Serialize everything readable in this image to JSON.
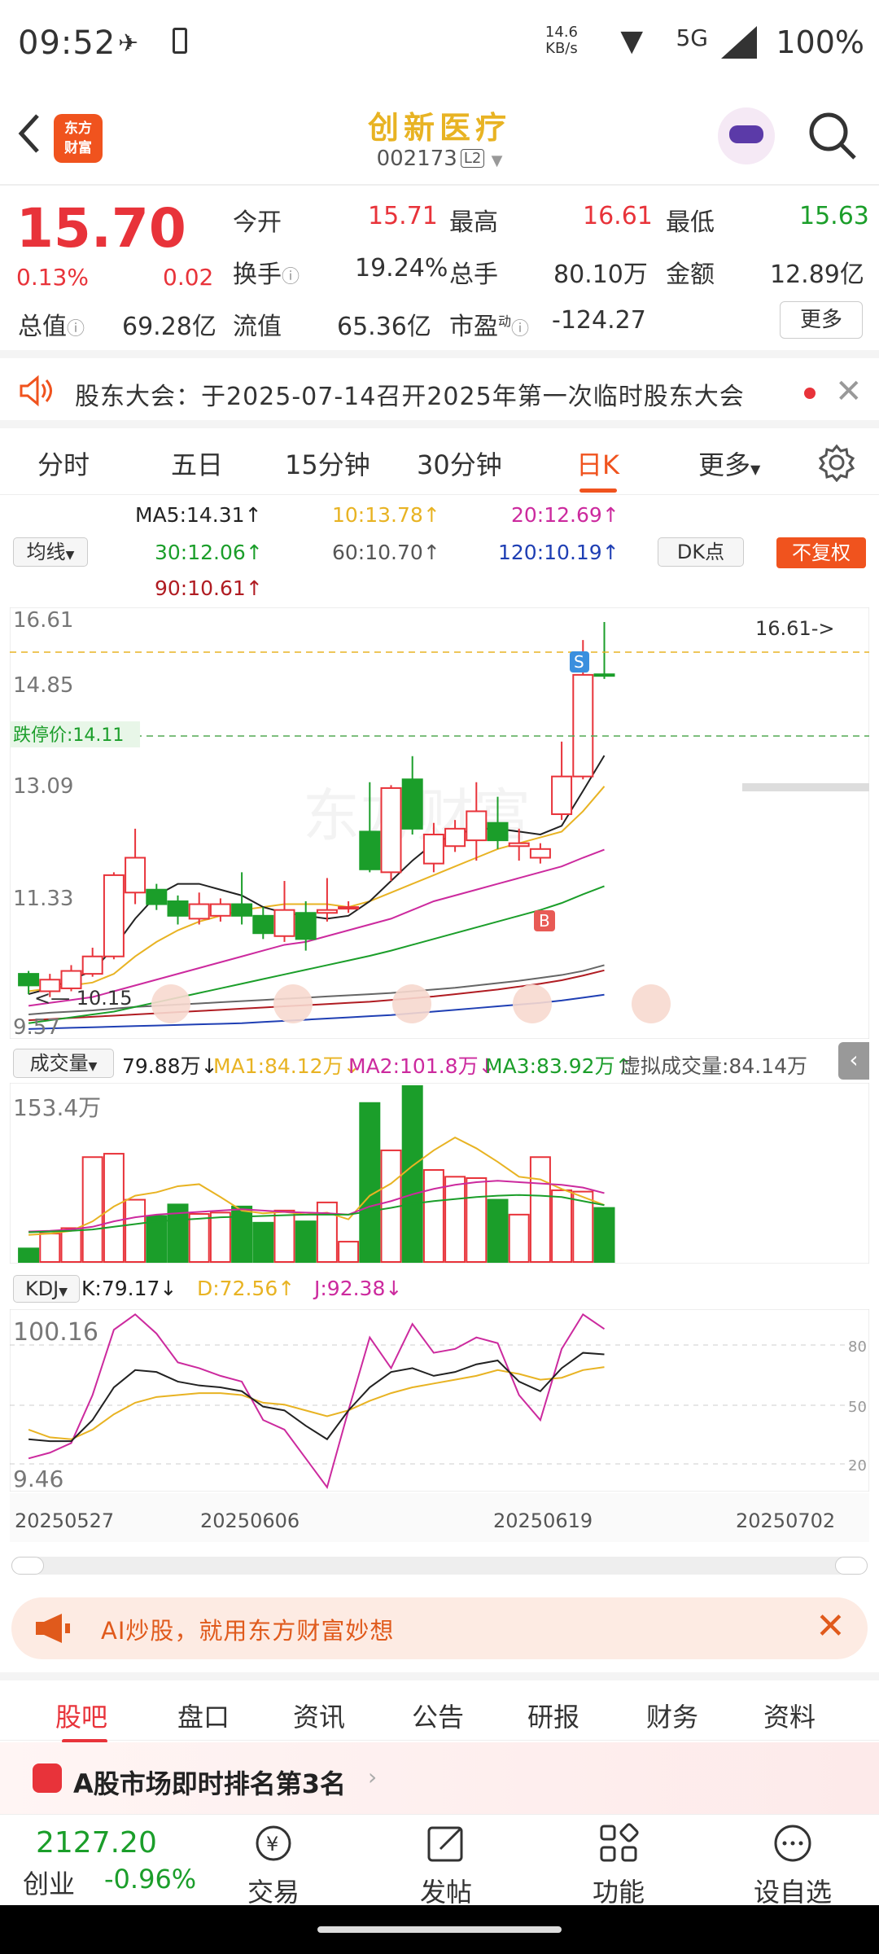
{
  "status_bar": {
    "time": "09:52",
    "net_speed_value": "14.6",
    "net_speed_unit": "KB/s",
    "network": "5G",
    "battery": "100%"
  },
  "header": {
    "logo_line1": "东方",
    "logo_line2": "财富",
    "stock_name": "创新医疗",
    "stock_code": "002173",
    "level_badge": "L2"
  },
  "quote": {
    "price": "15.70",
    "change_pct": "0.13%",
    "change": "0.02",
    "open_label": "今开",
    "open": "15.71",
    "high_label": "最高",
    "high": "16.61",
    "low_label": "最低",
    "low": "15.63",
    "turnover_label": "换手",
    "turnover": "19.24%",
    "volume_label": "总手",
    "volume": "80.10万",
    "amount_label": "金额",
    "amount": "12.89亿",
    "total_mv_label": "总值",
    "total_mv": "69.28亿",
    "float_mv_label": "流值",
    "float_mv": "65.36亿",
    "pe_label": "市盈",
    "pe_sup": "动",
    "pe": "-124.27",
    "more_label": "更多"
  },
  "notice": {
    "text": "股东大会：于2025-07-14召开2025年第一次临时股东大会"
  },
  "chart_tabs": [
    "分时",
    "五日",
    "15分钟",
    "30分钟",
    "日K",
    "更多"
  ],
  "ma_legend": {
    "ma_button": "均线",
    "ma5": "MA5:14.31",
    "ma10": "10:13.78",
    "ma20": "20:12.69",
    "ma30": "30:12.06",
    "ma60": "60:10.70",
    "ma120": "120:10.19",
    "ma90": "90:10.61",
    "dk_button": "DK点",
    "fq_button": "不复权"
  },
  "kline_labels": {
    "y_top": "16.61",
    "y_2": "14.85",
    "y_3": "13.09",
    "y_4": "11.33",
    "y_bottom": "9.57",
    "limit_down": "跌停价:14.11",
    "low_marker": "10.15",
    "high_marker": "16.61",
    "sell_tag": "S",
    "buy_tag": "B",
    "watermark": "东方财富"
  },
  "volume_legend": {
    "button": "成交量",
    "vol": "79.88万",
    "ma1": "MA1:84.12万",
    "ma2": "MA2:101.8万",
    "ma3": "MA3:83.92万",
    "virtual": "虚拟成交量:84.14万",
    "y_top": "153.4万"
  },
  "kdj_legend": {
    "button": "KDJ",
    "k": "K:79.17",
    "d": "D:72.56",
    "j": "J:92.38",
    "y_top": "100.16",
    "y_bottom": "9.46",
    "r80": "80",
    "r50": "50",
    "r20": "20"
  },
  "date_axis": [
    "20250527",
    "20250606",
    "20250619",
    "20250702"
  ],
  "chart_data": {
    "type": "candlestick",
    "title": "",
    "ylim": [
      9.57,
      16.61
    ],
    "candles": [
      {
        "o": 10.55,
        "c": 10.35,
        "h": 10.6,
        "l": 10.2
      },
      {
        "o": 10.25,
        "c": 10.45,
        "h": 10.55,
        "l": 10.15
      },
      {
        "o": 10.3,
        "c": 10.6,
        "h": 10.7,
        "l": 10.25
      },
      {
        "o": 10.55,
        "c": 10.85,
        "h": 11.0,
        "l": 10.5
      },
      {
        "o": 10.85,
        "c": 12.25,
        "h": 12.3,
        "l": 10.8
      },
      {
        "o": 11.95,
        "c": 12.55,
        "h": 13.05,
        "l": 11.75
      },
      {
        "o": 12.0,
        "c": 11.75,
        "h": 12.1,
        "l": 11.65
      },
      {
        "o": 11.8,
        "c": 11.55,
        "h": 11.9,
        "l": 11.4
      },
      {
        "o": 11.5,
        "c": 11.75,
        "h": 11.95,
        "l": 11.4
      },
      {
        "o": 11.55,
        "c": 11.75,
        "h": 11.85,
        "l": 11.45
      },
      {
        "o": 11.75,
        "c": 11.55,
        "h": 12.3,
        "l": 11.4
      },
      {
        "o": 11.55,
        "c": 11.25,
        "h": 11.7,
        "l": 11.15
      },
      {
        "o": 11.2,
        "c": 11.65,
        "h": 12.15,
        "l": 11.1
      },
      {
        "o": 11.6,
        "c": 11.15,
        "h": 11.8,
        "l": 10.95
      },
      {
        "o": 11.6,
        "c": 11.65,
        "h": 12.2,
        "l": 11.45
      },
      {
        "o": 11.7,
        "c": 11.7,
        "h": 11.8,
        "l": 11.6
      },
      {
        "o": 13.0,
        "c": 12.35,
        "h": 13.85,
        "l": 12.3
      },
      {
        "o": 12.3,
        "c": 13.75,
        "h": 13.8,
        "l": 12.15
      },
      {
        "o": 13.9,
        "c": 13.05,
        "h": 14.3,
        "l": 12.95
      },
      {
        "o": 12.45,
        "c": 12.95,
        "h": 13.15,
        "l": 12.3
      },
      {
        "o": 12.75,
        "c": 13.05,
        "h": 13.2,
        "l": 12.65
      },
      {
        "o": 12.85,
        "c": 13.35,
        "h": 13.85,
        "l": 12.5
      },
      {
        "o": 13.15,
        "c": 12.85,
        "h": 13.6,
        "l": 12.7
      },
      {
        "o": 12.75,
        "c": 12.8,
        "h": 13.05,
        "l": 12.5
      },
      {
        "o": 12.55,
        "c": 12.7,
        "h": 12.8,
        "l": 12.45
      },
      {
        "o": 13.3,
        "c": 13.95,
        "h": 14.55,
        "l": 13.2
      },
      {
        "o": 13.95,
        "c": 15.7,
        "h": 16.3,
        "l": 13.9
      },
      {
        "o": 15.71,
        "c": 15.7,
        "h": 16.61,
        "l": 15.63
      }
    ],
    "ma5": [
      10.2,
      10.3,
      10.45,
      10.6,
      11.0,
      11.5,
      11.9,
      12.1,
      12.1,
      12.0,
      11.9,
      11.7,
      11.6,
      11.55,
      11.5,
      11.55,
      11.8,
      12.15,
      12.5,
      12.8,
      12.95,
      13.05,
      13.05,
      13.0,
      12.95,
      13.1,
      13.7,
      14.31
    ],
    "ma10": [
      10.25,
      10.3,
      10.35,
      10.4,
      10.55,
      10.85,
      11.1,
      11.3,
      11.45,
      11.55,
      11.65,
      11.7,
      11.75,
      11.75,
      11.75,
      11.7,
      11.8,
      11.95,
      12.1,
      12.25,
      12.4,
      12.55,
      12.7,
      12.8,
      12.9,
      13.0,
      13.35,
      13.78
    ],
    "ma20": [
      10.0,
      10.05,
      10.1,
      10.15,
      10.25,
      10.35,
      10.45,
      10.55,
      10.65,
      10.75,
      10.85,
      10.95,
      11.05,
      11.1,
      11.2,
      11.3,
      11.4,
      11.5,
      11.65,
      11.8,
      11.9,
      12.0,
      12.1,
      12.2,
      12.3,
      12.4,
      12.55,
      12.69
    ],
    "ma30": [
      9.7,
      9.75,
      9.8,
      9.85,
      9.9,
      9.98,
      10.06,
      10.14,
      10.22,
      10.3,
      10.38,
      10.46,
      10.54,
      10.62,
      10.7,
      10.78,
      10.86,
      10.95,
      11.05,
      11.15,
      11.25,
      11.35,
      11.45,
      11.55,
      11.65,
      11.77,
      11.92,
      12.06
    ],
    "ma60": [
      9.85,
      9.88,
      9.9,
      9.92,
      9.95,
      9.98,
      10.0,
      10.02,
      10.04,
      10.06,
      10.08,
      10.1,
      10.12,
      10.14,
      10.16,
      10.18,
      10.2,
      10.22,
      10.25,
      10.28,
      10.31,
      10.35,
      10.39,
      10.43,
      10.48,
      10.53,
      10.6,
      10.7
    ],
    "ma90": [
      9.75,
      9.77,
      9.79,
      9.81,
      9.83,
      9.85,
      9.87,
      9.89,
      9.91,
      9.93,
      9.95,
      9.97,
      9.99,
      10.01,
      10.03,
      10.05,
      10.07,
      10.1,
      10.13,
      10.16,
      10.2,
      10.24,
      10.28,
      10.33,
      10.38,
      10.44,
      10.52,
      10.61
    ],
    "ma120": [
      9.6,
      9.61,
      9.62,
      9.63,
      9.64,
      9.65,
      9.66,
      9.67,
      9.68,
      9.69,
      9.7,
      9.72,
      9.74,
      9.76,
      9.78,
      9.8,
      9.82,
      9.84,
      9.87,
      9.9,
      9.93,
      9.96,
      9.99,
      10.02,
      10.05,
      10.09,
      10.14,
      10.19
    ],
    "volume": [
      20,
      42,
      50,
      155,
      160,
      92,
      68,
      85,
      71,
      73,
      82,
      58,
      76,
      60,
      88,
      30,
      235,
      165,
      260,
      136,
      126,
      124,
      92,
      70,
      155,
      106,
      104,
      79.88
    ],
    "vol_ma1": [
      40,
      42,
      46,
      60,
      82,
      98,
      103,
      112,
      115,
      96,
      76,
      72,
      74,
      70,
      73,
      63,
      98,
      116,
      142,
      165,
      184,
      168,
      148,
      126,
      122,
      108,
      96,
      84.12
    ],
    "vol_ma2": [
      45,
      46,
      48,
      52,
      60,
      66,
      70,
      72,
      74,
      76,
      78,
      76,
      74,
      73,
      72,
      70,
      82,
      90,
      100,
      108,
      114,
      118,
      120,
      118,
      116,
      114,
      110,
      101.8
    ],
    "vol_ma3": [
      44,
      45,
      46,
      48,
      52,
      56,
      60,
      62,
      64,
      66,
      67,
      68,
      69,
      70,
      70,
      70,
      75,
      80,
      86,
      90,
      93,
      96,
      98,
      99,
      98,
      96,
      90,
      83.92
    ],
    "kdj_k": [
      35,
      34,
      34,
      45,
      62,
      71,
      70,
      65,
      63,
      62,
      60,
      52,
      50,
      42,
      35,
      50,
      62,
      70,
      72,
      68,
      70,
      74,
      76,
      65,
      60,
      72,
      80,
      79.17
    ],
    "kdj_d": [
      40,
      36,
      35,
      40,
      48,
      54,
      57,
      58,
      59,
      59,
      58,
      54,
      53,
      50,
      47,
      50,
      55,
      59,
      62,
      64,
      66,
      68,
      71,
      69,
      66,
      67,
      71,
      72.56
    ],
    "kdj_j": [
      25,
      28,
      33,
      58,
      92,
      100,
      90,
      75,
      72,
      68,
      65,
      45,
      40,
      25,
      10,
      50,
      88,
      72,
      95,
      80,
      82,
      88,
      85,
      58,
      45,
      82,
      100,
      92.38
    ]
  },
  "ai_bar": {
    "text": "AI炒股，就用东方财富妙想"
  },
  "bottom_tabs": [
    "股吧",
    "盘口",
    "资讯",
    "公告",
    "研报",
    "财务",
    "资料"
  ],
  "rank": {
    "text": "A股市场即时排名第3名"
  },
  "bottom_bar": {
    "index_value": "2127.20",
    "index_name": "创业",
    "index_pct": "-0.96%",
    "trade": "交易",
    "post": "发帖",
    "functions": "功能",
    "watchlist": "设自选"
  },
  "colors": {
    "up": "#e8333a",
    "down": "#1b9e2a",
    "accent": "#f0531e"
  }
}
